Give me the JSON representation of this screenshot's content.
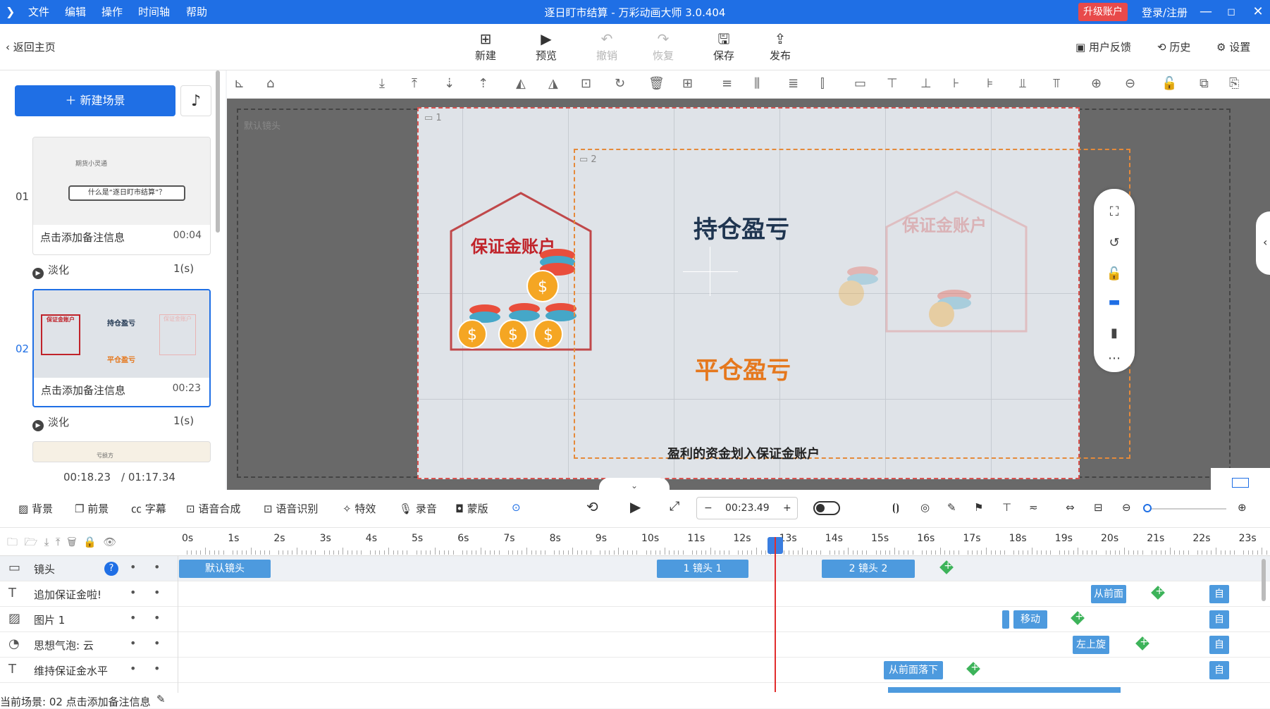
{
  "titlebar": {
    "menus": [
      "文件",
      "编辑",
      "操作",
      "时间轴",
      "帮助"
    ],
    "title": "逐日盯市结算 - 万彩动画大师 3.0.404",
    "upgrade": "升级账户",
    "login": "登录/注册"
  },
  "toolbar": {
    "back": "返回主页",
    "new": "新建",
    "preview": "预览",
    "undo": "撤销",
    "redo": "恢复",
    "save": "保存",
    "publish": "发布",
    "feedback": "用户反馈",
    "history": "历史",
    "settings": "设置"
  },
  "scenes": {
    "new_scene": "新建场景",
    "items": [
      {
        "num": "01",
        "note": "点击添加备注信息",
        "time": "00:04",
        "thumb_title": "什么是“逐日盯市结算”？",
        "thumb_sub": "期货小灵通",
        "transition": "淡化",
        "dur": "1(s)"
      },
      {
        "num": "02",
        "note": "点击添加备注信息",
        "time": "00:23",
        "thumb_t1": "保证金账户",
        "thumb_t2": "持仓盈亏",
        "thumb_t3": "平仓盈亏",
        "thumb_t4": "保证金账户",
        "transition": "淡化",
        "dur": "1(s)"
      }
    ],
    "third_thumb": "亏损方",
    "current_time": "00:18.23",
    "total_time": "/ 01:17.34"
  },
  "canvas": {
    "default_lens": "默认镜头",
    "lens1": "1",
    "lens2": "2",
    "house_title": "保证金账户",
    "hold_pl": "持仓盈亏",
    "close_pl": "平仓盈亏",
    "bottom_text": "盈利的资金划入保证金账户",
    "ghost_house_title": "保证金账户"
  },
  "timeline_toolbar": {
    "bg": "背景",
    "fg": "前景",
    "subtitle": "字幕",
    "tts": "语音合成",
    "asr": "语音识别",
    "effects": "特效",
    "record": "录音",
    "mask": "蒙版",
    "time": "00:23.49"
  },
  "ruler": [
    "0s",
    "1s",
    "2s",
    "3s",
    "4s",
    "5s",
    "6s",
    "7s",
    "8s",
    "9s",
    "10s",
    "11s",
    "12s",
    "13s",
    "14s",
    "15s",
    "16s",
    "17s",
    "18s",
    "19s",
    "20s",
    "21s",
    "22s",
    "23s"
  ],
  "tracks": [
    {
      "name": "镜头",
      "clips": [
        "默认镜头",
        "1 镜头 1",
        "2 镜头 2"
      ]
    },
    {
      "name": "追加保证金啦!",
      "clips": [
        "从前面",
        "自"
      ]
    },
    {
      "name": "图片 1",
      "clips": [
        "移动",
        "自"
      ]
    },
    {
      "name": "思想气泡: 云",
      "clips": [
        "左上旋",
        "自"
      ]
    },
    {
      "name": "维持保证金水平",
      "clips": [
        "从前面落下",
        "自"
      ]
    }
  ],
  "status": "当前场景: 02   点击添加备注信息",
  "colors": {
    "accent": "#1f6fe5",
    "upgrade": "#e84a4a",
    "clip": "#4d9ade",
    "keyframe": "#3db35a",
    "playhead": "#e12d2d",
    "red_text": "#c0232a",
    "orange_text": "#e5781e"
  }
}
